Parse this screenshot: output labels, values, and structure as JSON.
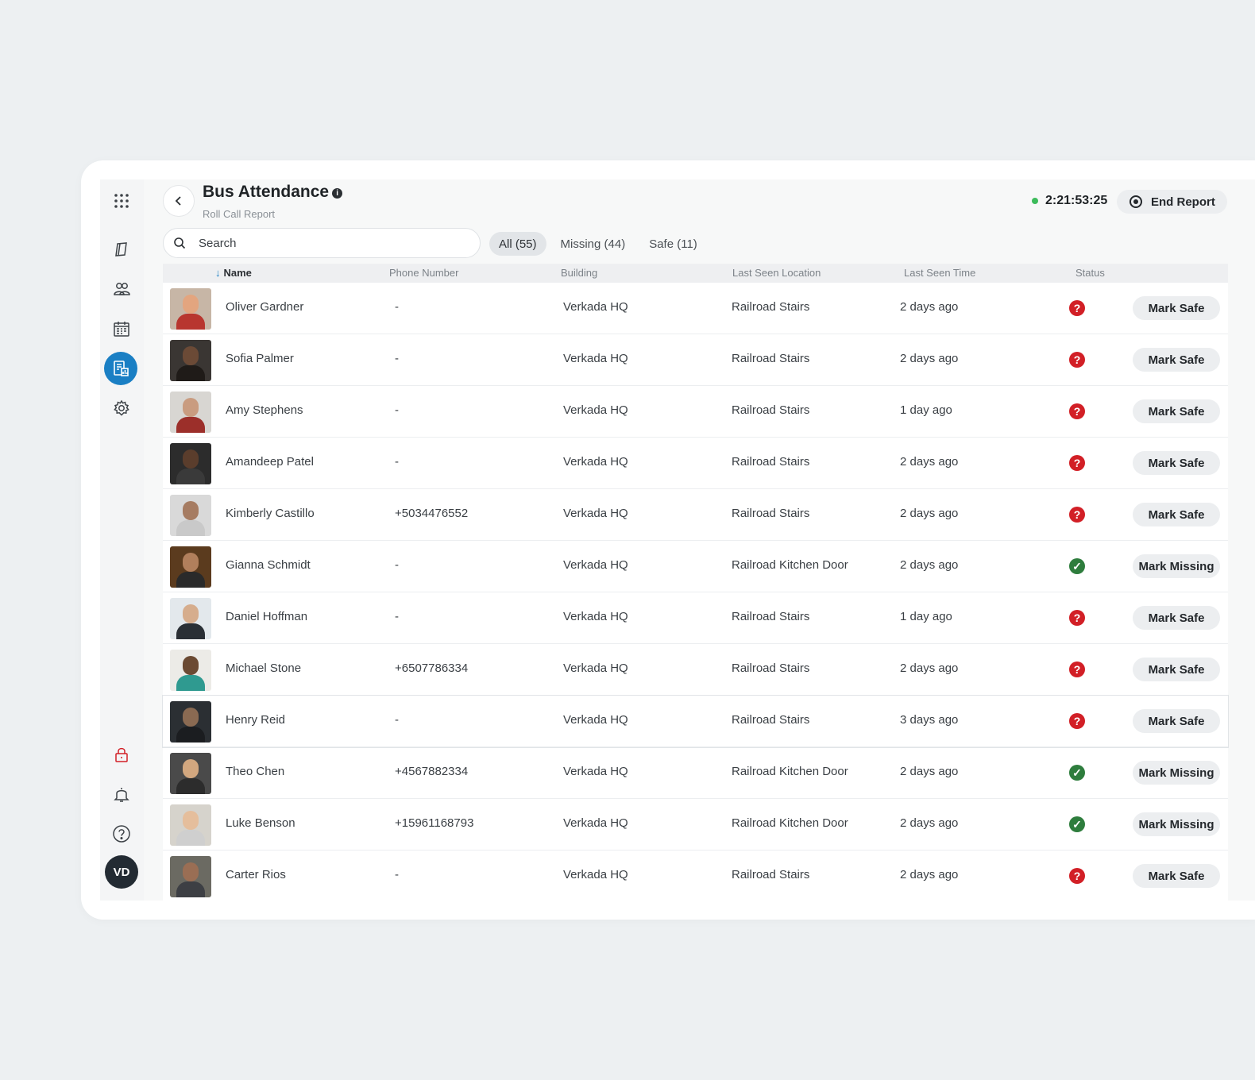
{
  "header": {
    "title": "Bus Attendance",
    "subtitle": "Roll Call Report",
    "timer": "2:21:53:25",
    "end_report_label": "End Report"
  },
  "search": {
    "placeholder": "Search"
  },
  "tabs": [
    {
      "label": "All (55)",
      "active": true
    },
    {
      "label": "Missing (44)",
      "active": false
    },
    {
      "label": "Safe (11)",
      "active": false
    }
  ],
  "columns": {
    "name": "Name",
    "phone": "Phone Number",
    "building": "Building",
    "location": "Last Seen Location",
    "time": "Last Seen Time",
    "status": "Status"
  },
  "sidebar": {
    "icons": [
      "apps-grid-icon",
      "logbook-icon",
      "people-icon",
      "calendar-icon",
      "report-icon",
      "gear-icon",
      "lock-icon",
      "bell-icon",
      "help-icon"
    ],
    "avatar_initials": "VD"
  },
  "colors": {
    "accent": "#1a7fc4",
    "missing": "#d21f26",
    "safe": "#2e7d3d",
    "live": "#3dbb5b"
  },
  "rows": [
    {
      "name": "Oliver Gardner",
      "phone": "-",
      "building": "Verkada HQ",
      "location": "Railroad Stairs",
      "time": "2 days ago",
      "status": "missing",
      "action": "Mark Safe"
    },
    {
      "name": "Sofia Palmer",
      "phone": "-",
      "building": "Verkada HQ",
      "location": "Railroad Stairs",
      "time": "2 days ago",
      "status": "missing",
      "action": "Mark Safe"
    },
    {
      "name": "Amy Stephens",
      "phone": "-",
      "building": "Verkada HQ",
      "location": "Railroad Stairs",
      "time": "1 day ago",
      "status": "missing",
      "action": "Mark Safe"
    },
    {
      "name": "Amandeep Patel",
      "phone": "-",
      "building": "Verkada HQ",
      "location": "Railroad Stairs",
      "time": "2 days ago",
      "status": "missing",
      "action": "Mark Safe"
    },
    {
      "name": "Kimberly Castillo",
      "phone": "+5034476552",
      "building": "Verkada HQ",
      "location": "Railroad Stairs",
      "time": "2 days ago",
      "status": "missing",
      "action": "Mark Safe"
    },
    {
      "name": "Gianna Schmidt",
      "phone": "-",
      "building": "Verkada HQ",
      "location": "Railroad Kitchen Door",
      "time": "2 days ago",
      "status": "safe",
      "action": "Mark Missing"
    },
    {
      "name": "Daniel Hoffman",
      "phone": "-",
      "building": "Verkada HQ",
      "location": "Railroad Stairs",
      "time": "1 day ago",
      "status": "missing",
      "action": "Mark Safe"
    },
    {
      "name": "Michael Stone",
      "phone": "+6507786334",
      "building": "Verkada HQ",
      "location": "Railroad Stairs",
      "time": "2 days ago",
      "status": "missing",
      "action": "Mark Safe"
    },
    {
      "name": "Henry Reid",
      "phone": "-",
      "building": "Verkada HQ",
      "location": "Railroad Stairs",
      "time": "3 days ago",
      "status": "missing",
      "action": "Mark Safe"
    },
    {
      "name": "Theo Chen",
      "phone": "+4567882334",
      "building": "Verkada HQ",
      "location": "Railroad Kitchen Door",
      "time": "2 days ago",
      "status": "safe",
      "action": "Mark Missing"
    },
    {
      "name": "Luke Benson",
      "phone": "+15961168793",
      "building": "Verkada HQ",
      "location": "Railroad Kitchen Door",
      "time": "2 days ago",
      "status": "safe",
      "action": "Mark Missing"
    },
    {
      "name": "Carter Rios",
      "phone": "-",
      "building": "Verkada HQ",
      "location": "Railroad Stairs",
      "time": "2 days ago",
      "status": "missing",
      "action": "Mark Safe"
    }
  ]
}
